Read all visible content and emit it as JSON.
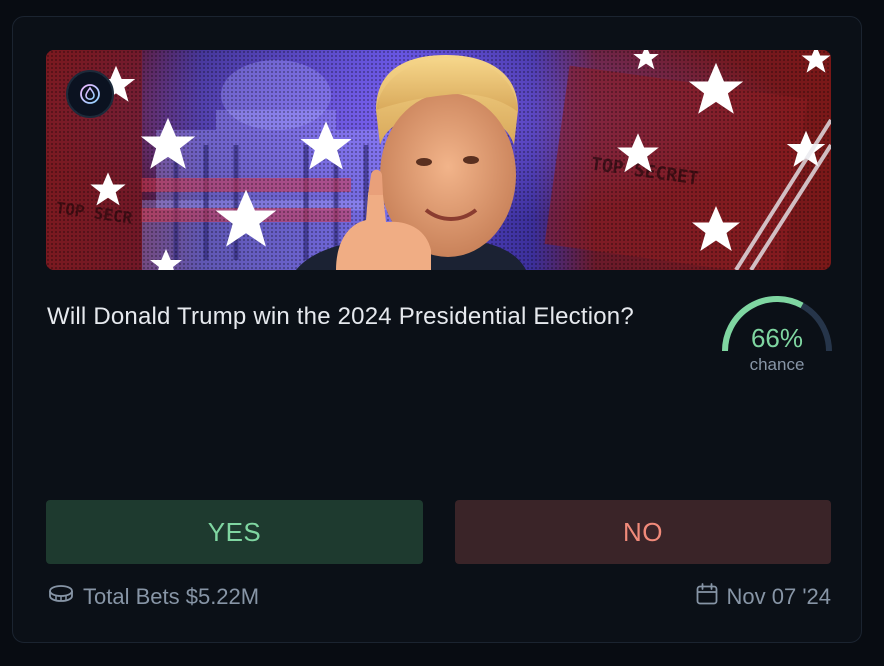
{
  "market": {
    "question": "Will Donald Trump win the 2024 Presidential Election?",
    "chance_percent": 66,
    "chance_text": "66%",
    "chance_label": "chance",
    "banner_icon": "drop-icon",
    "banner_image": "candidate-portrait-with-stars"
  },
  "actions": {
    "yes_label": "YES",
    "no_label": "NO"
  },
  "footer": {
    "total_bets_label": "Total Bets $5.22M",
    "total_bets_icon": "coin-stack-icon",
    "date_label": "Nov 07 '24",
    "date_icon": "calendar-icon"
  },
  "colors": {
    "yes_accent": "#7fd6a1",
    "no_accent": "#f08a7a",
    "gauge_track": "#26354a"
  }
}
